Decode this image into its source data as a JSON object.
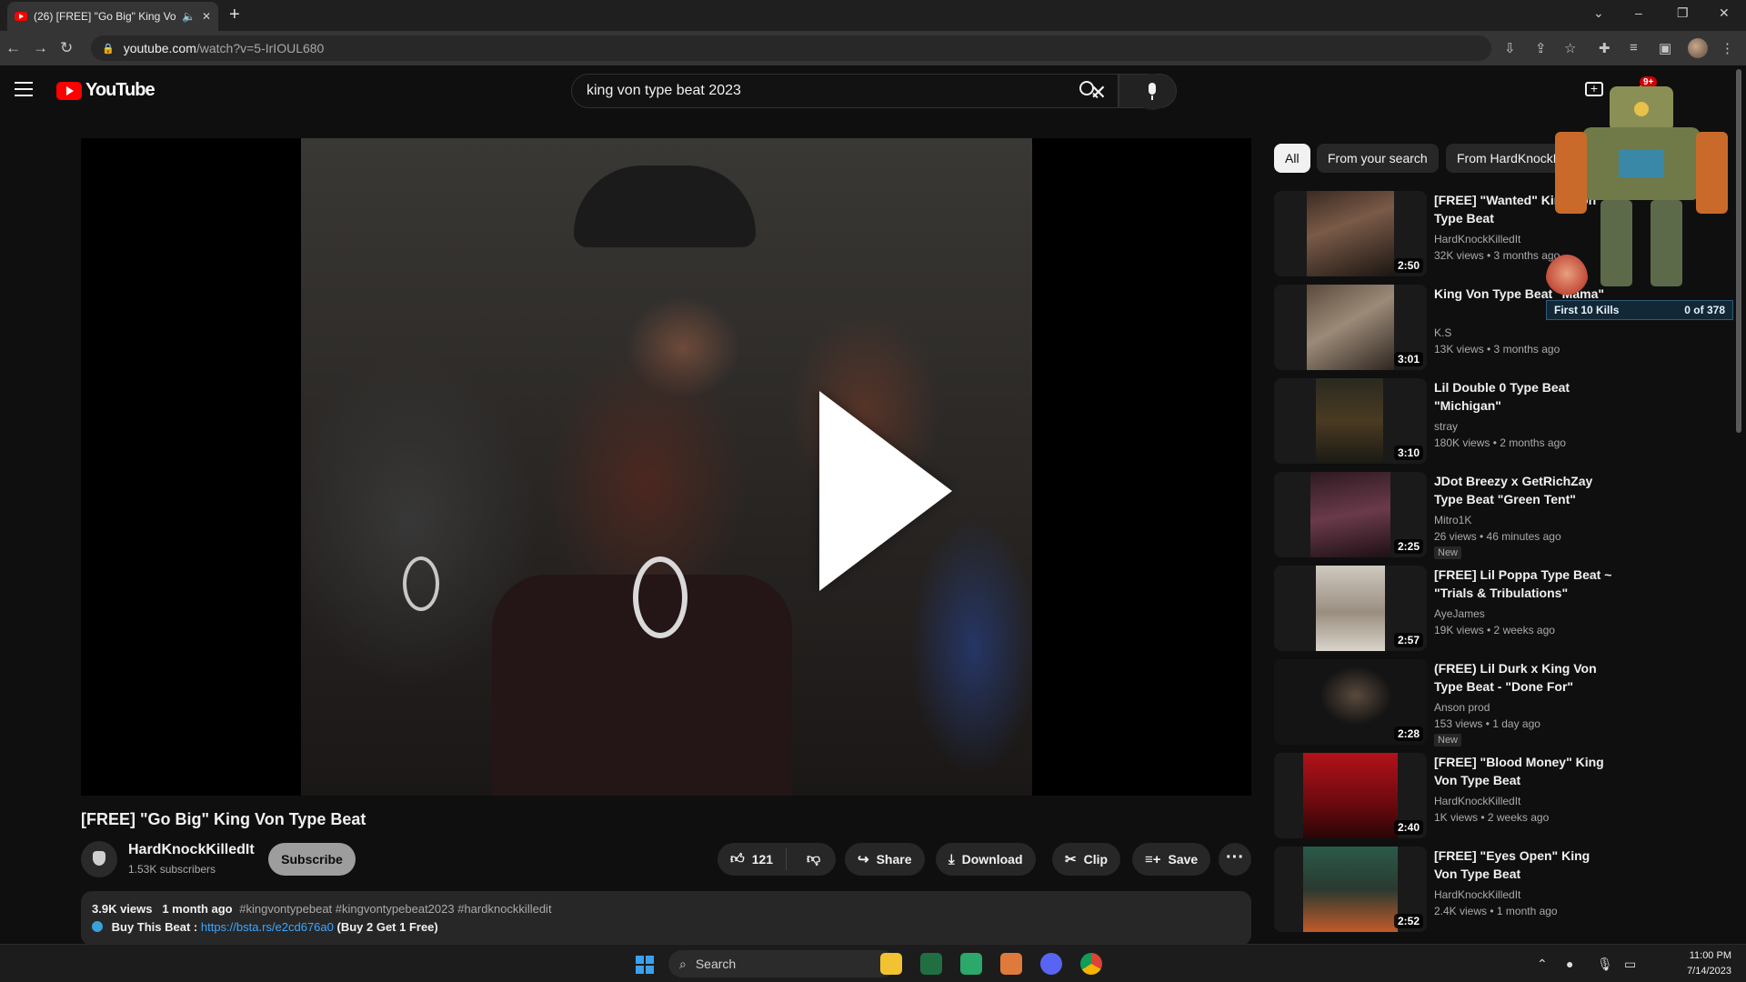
{
  "browser": {
    "tab_title": "(26) [FREE] \"Go Big\" King Vo",
    "url_host": "youtube.com",
    "url_path": "/watch?v=5-IrIOUL680",
    "new_tab": "+",
    "minimize": "–",
    "restore": "❐",
    "close": "✕"
  },
  "masthead": {
    "logo_text": "YouTube",
    "search_value": "king von type beat 2023",
    "notif_badge": "9+"
  },
  "video": {
    "title": "[FREE] \"Go Big\" King Von Type Beat",
    "channel": "HardKnockKilledIt",
    "subscribers": "1.53K subscribers",
    "subscribe_label": "Subscribe",
    "likes": "121",
    "share_label": "Share",
    "download_label": "Download",
    "clip_label": "Clip",
    "save_label": "Save",
    "more_label": "···",
    "views": "3.9K views",
    "age": "1 month ago",
    "tags": "#kingvontypebeat #kingvontypebeat2023 #hardknockkilledit",
    "buy_label": "Buy This Beat :",
    "buy_link": "https://bsta.rs/e2cd676a0",
    "buy_note": "(Buy 2 Get 1 Free)"
  },
  "filters": [
    "All",
    "From your search",
    "From HardKnockKilledIt"
  ],
  "recommendations": [
    {
      "title": "[FREE] \"Wanted\" King Von Type Beat",
      "channel": "HardKnockKilledIt",
      "views": "32K views • 3 months ago",
      "duration": "2:50",
      "new": ""
    },
    {
      "title": "King Von Type Beat \"Mama\"",
      "channel": "K.S",
      "views": "13K views • 3 months ago",
      "duration": "3:01",
      "new": ""
    },
    {
      "title": "Lil Double 0 Type Beat \"Michigan\"",
      "channel": "stray",
      "views": "180K views • 2 months ago",
      "duration": "3:10",
      "new": ""
    },
    {
      "title": "JDot Breezy x GetRichZay Type Beat \"Green Tent\"",
      "channel": "Mitro1K",
      "views": "26 views • 46 minutes ago",
      "duration": "2:25",
      "new": "New"
    },
    {
      "title": "[FREE] Lil Poppa Type Beat ~ \"Trials & Tribulations\"",
      "channel": "AyeJames",
      "views": "19K views • 2 weeks ago",
      "duration": "2:57",
      "new": ""
    },
    {
      "title": "(FREE) Lil Durk x King Von Type Beat - \"Done For\"",
      "channel": "Anson prod",
      "views": "153 views • 1 day ago",
      "duration": "2:28",
      "new": "New"
    },
    {
      "title": "[FREE] \"Blood Money\" King Von Type Beat",
      "channel": "HardKnockKilledIt",
      "views": "1K views • 2 weeks ago",
      "duration": "2:40",
      "new": ""
    },
    {
      "title": "[FREE] \"Eyes Open\" King Von Type Beat",
      "channel": "HardKnockKilledIt",
      "views": "2.4K views • 1 month ago",
      "duration": "2:52",
      "new": ""
    }
  ],
  "overlay": {
    "achievement": "First 10 Kills",
    "progress": "0 of 378"
  },
  "taskbar": {
    "search_placeholder": "Search",
    "time": "11:00 PM",
    "date": "7/14/2023"
  }
}
